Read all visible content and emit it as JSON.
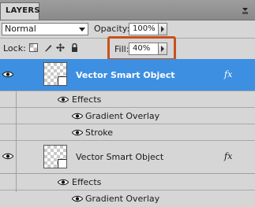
{
  "panel": {
    "tab_label": "LAYERS"
  },
  "blend": {
    "mode": "Normal"
  },
  "opacity": {
    "label": "Opacity:",
    "value": "100%"
  },
  "lock": {
    "label": "Lock:"
  },
  "fill": {
    "label": "Fill:",
    "value": "40%"
  },
  "layers": [
    {
      "name": "Vector Smart Object",
      "fx": "fx",
      "selected": true,
      "effects_label": "Effects",
      "effects": [
        "Gradient Overlay",
        "Stroke"
      ]
    },
    {
      "name": "Vector Smart Object",
      "fx": "fx",
      "selected": false,
      "effects_label": "Effects",
      "effects": [
        "Gradient Overlay"
      ]
    }
  ],
  "colors": {
    "selected": "#3d8fe1",
    "highlight": "#c8501e",
    "panel": "#d6d6d6"
  }
}
